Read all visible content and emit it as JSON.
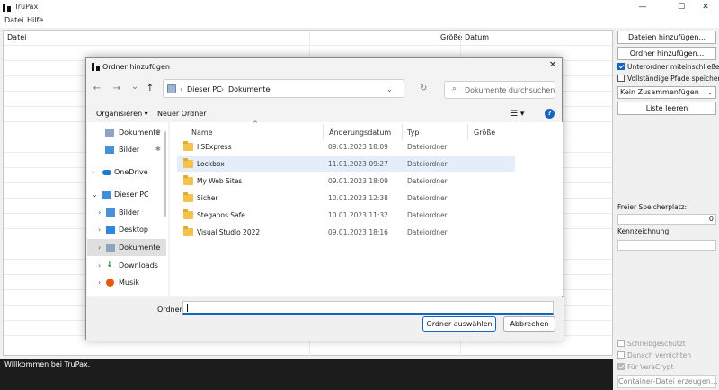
{
  "app": {
    "title": "TruPax",
    "window_controls": {
      "minimize": "—",
      "maximize": "☐",
      "close": "✕"
    }
  },
  "menu": [
    "Datei",
    "Hilfe"
  ],
  "filelist": {
    "columns": [
      "Datei",
      "Größe",
      "Datum"
    ]
  },
  "right_panel": {
    "add_files_button": "Dateien hinzufügen...",
    "add_folder_button": "Ordner hinzufügen...",
    "include_subfolders": {
      "label": "Unterordner miteinschließen",
      "checked": true
    },
    "store_full_paths": {
      "label": "Vollständige Pfade speichern",
      "checked": false
    },
    "merge_select": "Kein Zusammenfügen",
    "clear_list_button": "Liste leeren",
    "free_space_label": "Freier Speicherplatz:",
    "free_space_value": "0",
    "label_label": "Kennzeichnung:",
    "label_value": "",
    "write_protected": {
      "label": "Schreibgeschützt",
      "checked": false
    },
    "wipe_after": {
      "label": "Danach vernichten",
      "checked": false
    },
    "veracrypt": {
      "label": "Für VeraCrypt",
      "checked": true
    },
    "create_container_button": "Container-Datei erzeugen..."
  },
  "status": "Willkommen bei TruPax.",
  "dialog": {
    "title": "Ordner hinzufügen",
    "close": "✕",
    "nav": {
      "back": "←",
      "forward": "→",
      "dropdown": "⌄",
      "up": "↑"
    },
    "address": [
      "Dieser PC",
      "Dokumente"
    ],
    "search_placeholder": "Dokumente durchsuchen",
    "toolbar": {
      "organize": "Organisieren",
      "new_folder": "Neuer Ordner"
    },
    "navpane": [
      {
        "label": "Dokumente",
        "icon": "documents-icon",
        "pinned": true
      },
      {
        "label": "Bilder",
        "icon": "pictures-icon",
        "pinned": true
      },
      {
        "label": "OneDrive",
        "icon": "cloud-icon"
      },
      {
        "label": "Dieser PC",
        "icon": "computer-icon",
        "expanded": true
      },
      {
        "label": "Bilder",
        "icon": "pictures-icon"
      },
      {
        "label": "Desktop",
        "icon": "desktop-icon"
      },
      {
        "label": "Dokumente",
        "icon": "documents-icon",
        "selected": true
      },
      {
        "label": "Downloads",
        "icon": "download-icon"
      },
      {
        "label": "Musik",
        "icon": "music-icon"
      }
    ],
    "columns": [
      "Name",
      "Änderungsdatum",
      "Typ",
      "Größe"
    ],
    "items": [
      {
        "name": "IISExpress",
        "date": "09.01.2023 18:09",
        "type": "Dateiordner"
      },
      {
        "name": "Lockbox",
        "date": "11.01.2023 09:27",
        "type": "Dateiordner",
        "selected": true
      },
      {
        "name": "My Web Sites",
        "date": "09.01.2023 18:09",
        "type": "Dateiordner"
      },
      {
        "name": "Sicher",
        "date": "10.01.2023 12:38",
        "type": "Dateiordner"
      },
      {
        "name": "Steganos Safe",
        "date": "10.01.2023 11:32",
        "type": "Dateiordner"
      },
      {
        "name": "Visual Studio 2022",
        "date": "09.01.2023 18:16",
        "type": "Dateiordner"
      }
    ],
    "folder_label": "Ordner:",
    "folder_value": "",
    "select_button": "Ordner auswählen",
    "cancel_button": "Abbrechen"
  },
  "colors": {
    "accent": "#1565c0",
    "selection": "#e4eefa",
    "status_bg": "#1c1c1c"
  }
}
